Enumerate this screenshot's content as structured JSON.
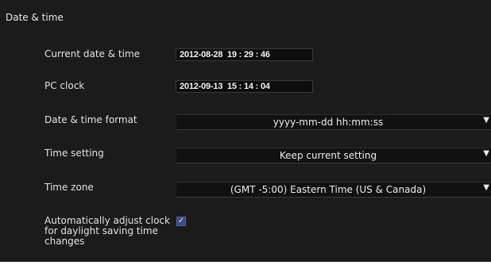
{
  "section": {
    "title": "Date & time"
  },
  "current_datetime": {
    "label": "Current date & time",
    "value": "2012-08-28  19 : 29 : 46"
  },
  "pc_clock": {
    "label": "PC clock",
    "value": "2012-09-13  15 : 14 : 04"
  },
  "datetime_format": {
    "label": "Date & time format",
    "selected": "yyyy-mm-dd hh:mm:ss"
  },
  "time_setting": {
    "label": "Time setting",
    "selected": "Keep current setting"
  },
  "time_zone": {
    "label": "Time zone",
    "selected": "(GMT -5:00) Eastern Time (US & Canada)"
  },
  "dst_adjust": {
    "label_lines": [
      "Automatically adjust clock",
      "for daylight saving time",
      "changes"
    ],
    "checked": true
  },
  "icons": {
    "dropdown_arrow": "▼",
    "checkmark": "✓"
  },
  "colors": {
    "panel_background": "#1b1b1b",
    "checkbox_fill": "#3a4a86"
  }
}
